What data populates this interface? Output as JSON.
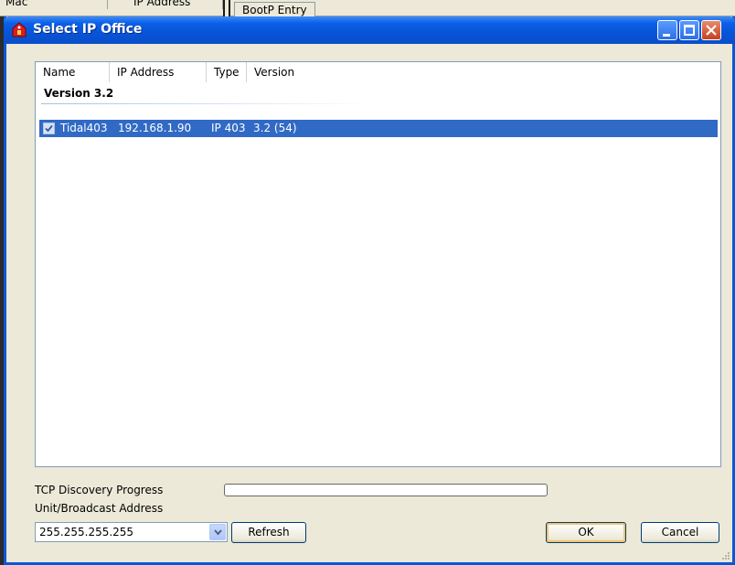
{
  "background": {
    "columns": [
      "Mac",
      "IP Address"
    ],
    "tab_label": "BootP Entry"
  },
  "window": {
    "title": "Select IP Office"
  },
  "list": {
    "columns": [
      "Name",
      "IP Address",
      "Type",
      "Version"
    ],
    "group_title": "Version 3.2",
    "rows": [
      {
        "name": "Tidal403",
        "ip": "192.168.1.90",
        "type": "IP 403",
        "version": "3.2 (54)",
        "checked": true,
        "selected": true
      }
    ]
  },
  "bottom": {
    "progress_label": "TCP Discovery Progress",
    "progress_value": 0,
    "unit_label": "Unit/Broadcast Address",
    "address_value": "255.255.255.255",
    "refresh_label": "Refresh",
    "ok_label": "OK",
    "cancel_label": "Cancel"
  },
  "colors": {
    "title_bar": "#0a5fe8",
    "selection": "#316ac5",
    "dialog_bg": "#ece9d8"
  },
  "icons": {
    "title": "ip-office-icon",
    "minimize": "minimize-icon",
    "maximize": "maximize-icon",
    "close": "close-icon",
    "dropdown": "chevron-down-icon",
    "checkbox": "checkbox-icon"
  }
}
